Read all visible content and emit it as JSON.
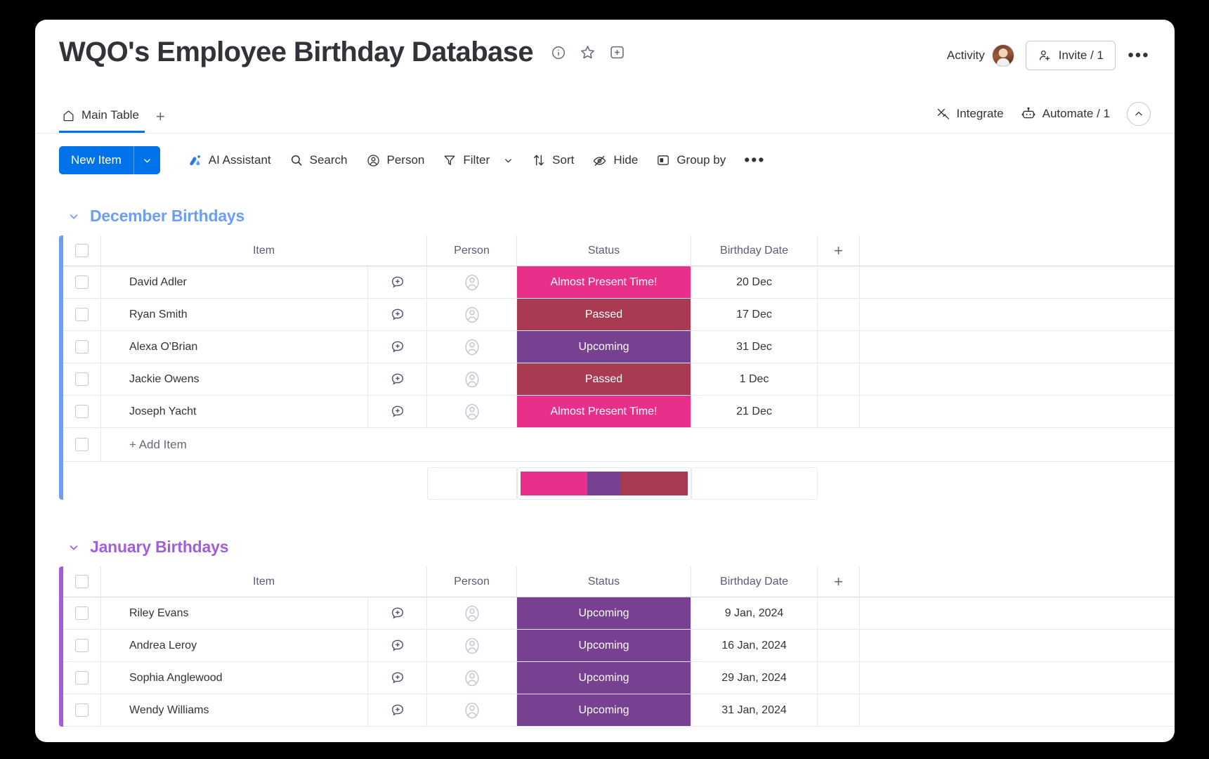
{
  "header": {
    "title": "WQO's Employee Birthday Database",
    "icons": [
      "info-icon",
      "star-icon",
      "add-board-icon"
    ],
    "activity_label": "Activity",
    "invite_label": "Invite / 1",
    "more_label": "•••"
  },
  "tabs": {
    "main_tab": "Main Table",
    "add_tab": "+",
    "integrate_label": "Integrate",
    "automate_label": "Automate / 1"
  },
  "toolbar": {
    "new_item": "New Item",
    "ai_assistant": "AI Assistant",
    "search": "Search",
    "person": "Person",
    "filter": "Filter",
    "sort": "Sort",
    "hide": "Hide",
    "group_by": "Group by",
    "more": "•••"
  },
  "columns": {
    "item": "Item",
    "person": "Person",
    "status": "Status",
    "birthday_date": "Birthday Date",
    "add_column": "+"
  },
  "add_item_label": "+ Add Item",
  "status_colors": {
    "almost_present": "#e8308a",
    "passed": "#a83a52",
    "upcoming": "#784091"
  },
  "groups": [
    {
      "name": "December Birthdays",
      "color": "#6c9ef8",
      "rows": [
        {
          "item": "David Adler",
          "status": "Almost Present Time!",
          "status_color": "#e8308a",
          "date": "20 Dec"
        },
        {
          "item": "Ryan Smith",
          "status": "Passed",
          "status_color": "#a83a52",
          "date": "17 Dec"
        },
        {
          "item": "Alexa O'Brian",
          "status": "Upcoming",
          "status_color": "#784091",
          "date": "31 Dec"
        },
        {
          "item": "Jackie Owens",
          "status": "Passed",
          "status_color": "#a83a52",
          "date": "1 Dec"
        },
        {
          "item": "Joseph Yacht",
          "status": "Almost Present Time!",
          "status_color": "#e8308a",
          "date": "21 Dec"
        }
      ],
      "summary": [
        {
          "label": "Almost Present Time!",
          "color": "#e8308a",
          "share": 40
        },
        {
          "label": "Upcoming",
          "color": "#784091",
          "share": 20
        },
        {
          "label": "Passed",
          "color": "#a83a52",
          "share": 40
        }
      ]
    },
    {
      "name": "January Birthdays",
      "color": "#a25ddc",
      "rows": [
        {
          "item": "Riley Evans",
          "status": "Upcoming",
          "status_color": "#784091",
          "date": "9 Jan, 2024"
        },
        {
          "item": "Andrea Leroy",
          "status": "Upcoming",
          "status_color": "#784091",
          "date": "16 Jan, 2024"
        },
        {
          "item": "Sophia Anglewood",
          "status": "Upcoming",
          "status_color": "#784091",
          "date": "29 Jan, 2024"
        },
        {
          "item": "Wendy Williams",
          "status": "Upcoming",
          "status_color": "#784091",
          "date": "31 Jan, 2024"
        }
      ],
      "summary": []
    }
  ]
}
